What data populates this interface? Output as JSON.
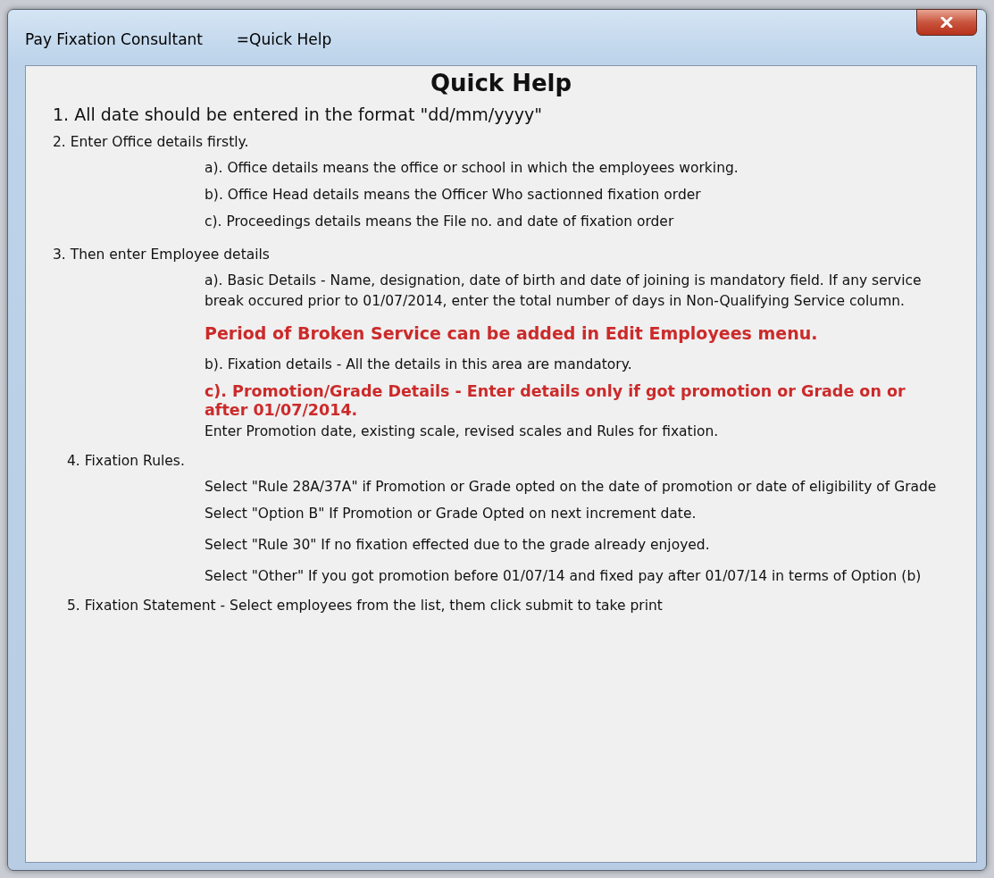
{
  "window": {
    "title": "Pay Fixation Consultant       =Quick Help"
  },
  "heading": "Quick Help",
  "blocks": [
    {
      "kind": "main",
      "text": "1. All date should be entered in the format \"dd/mm/yyyy\""
    },
    {
      "kind": "step",
      "text": "2. Enter Office details firstly."
    },
    {
      "kind": "detail",
      "text": "a). Office details means the office or school in which  the employees working."
    },
    {
      "kind": "detail",
      "text": "b). Office Head details means the Officer Who sactionned fixation order"
    },
    {
      "kind": "detail",
      "text": "c). Proceedings details means the File no. and date of fixation order"
    },
    {
      "kind": "step",
      "text": "3. Then enter Employee details"
    },
    {
      "kind": "detail",
      "text": "a). Basic Details - Name, designation, date of birth and date of joining is mandatory field. If any service break occured prior to 01/07/2014, enter the total number of days in Non-Qualifying Service column."
    },
    {
      "kind": "warning",
      "text": "Period of Broken Service can be added in Edit Employees menu."
    },
    {
      "kind": "detail",
      "text": "b). Fixation details - All the details in this area are mandatory."
    },
    {
      "kind": "warning-small",
      "text": "c). Promotion/Grade Details - Enter details only if got promotion or Grade on or after 01/07/2014."
    },
    {
      "kind": "continuation",
      "text": "Enter Promotion date, existing scale, revised scales and Rules for fixation."
    },
    {
      "kind": "step-inset",
      "text": "4. Fixation Rules."
    },
    {
      "kind": "detail",
      "text": "Select \"Rule 28A/37A\" if Promotion or Grade opted on the date of promotion or date of eligibility of Grade"
    },
    {
      "kind": "detail",
      "text": "Select \"Option B\" If Promotion or Grade Opted on next increment date."
    },
    {
      "kind": "detail-spaced",
      "text": "Select \"Rule 30\" If no fixation effected due to the grade already enjoyed."
    },
    {
      "kind": "detail-spaced",
      "text": "Select \"Other\" If you got promotion before 01/07/14 and fixed pay after 01/07/14 in terms of Option (b)"
    },
    {
      "kind": "step-inset",
      "text": "5. Fixation Statement - Select employees from the list, them click submit to take print"
    }
  ]
}
